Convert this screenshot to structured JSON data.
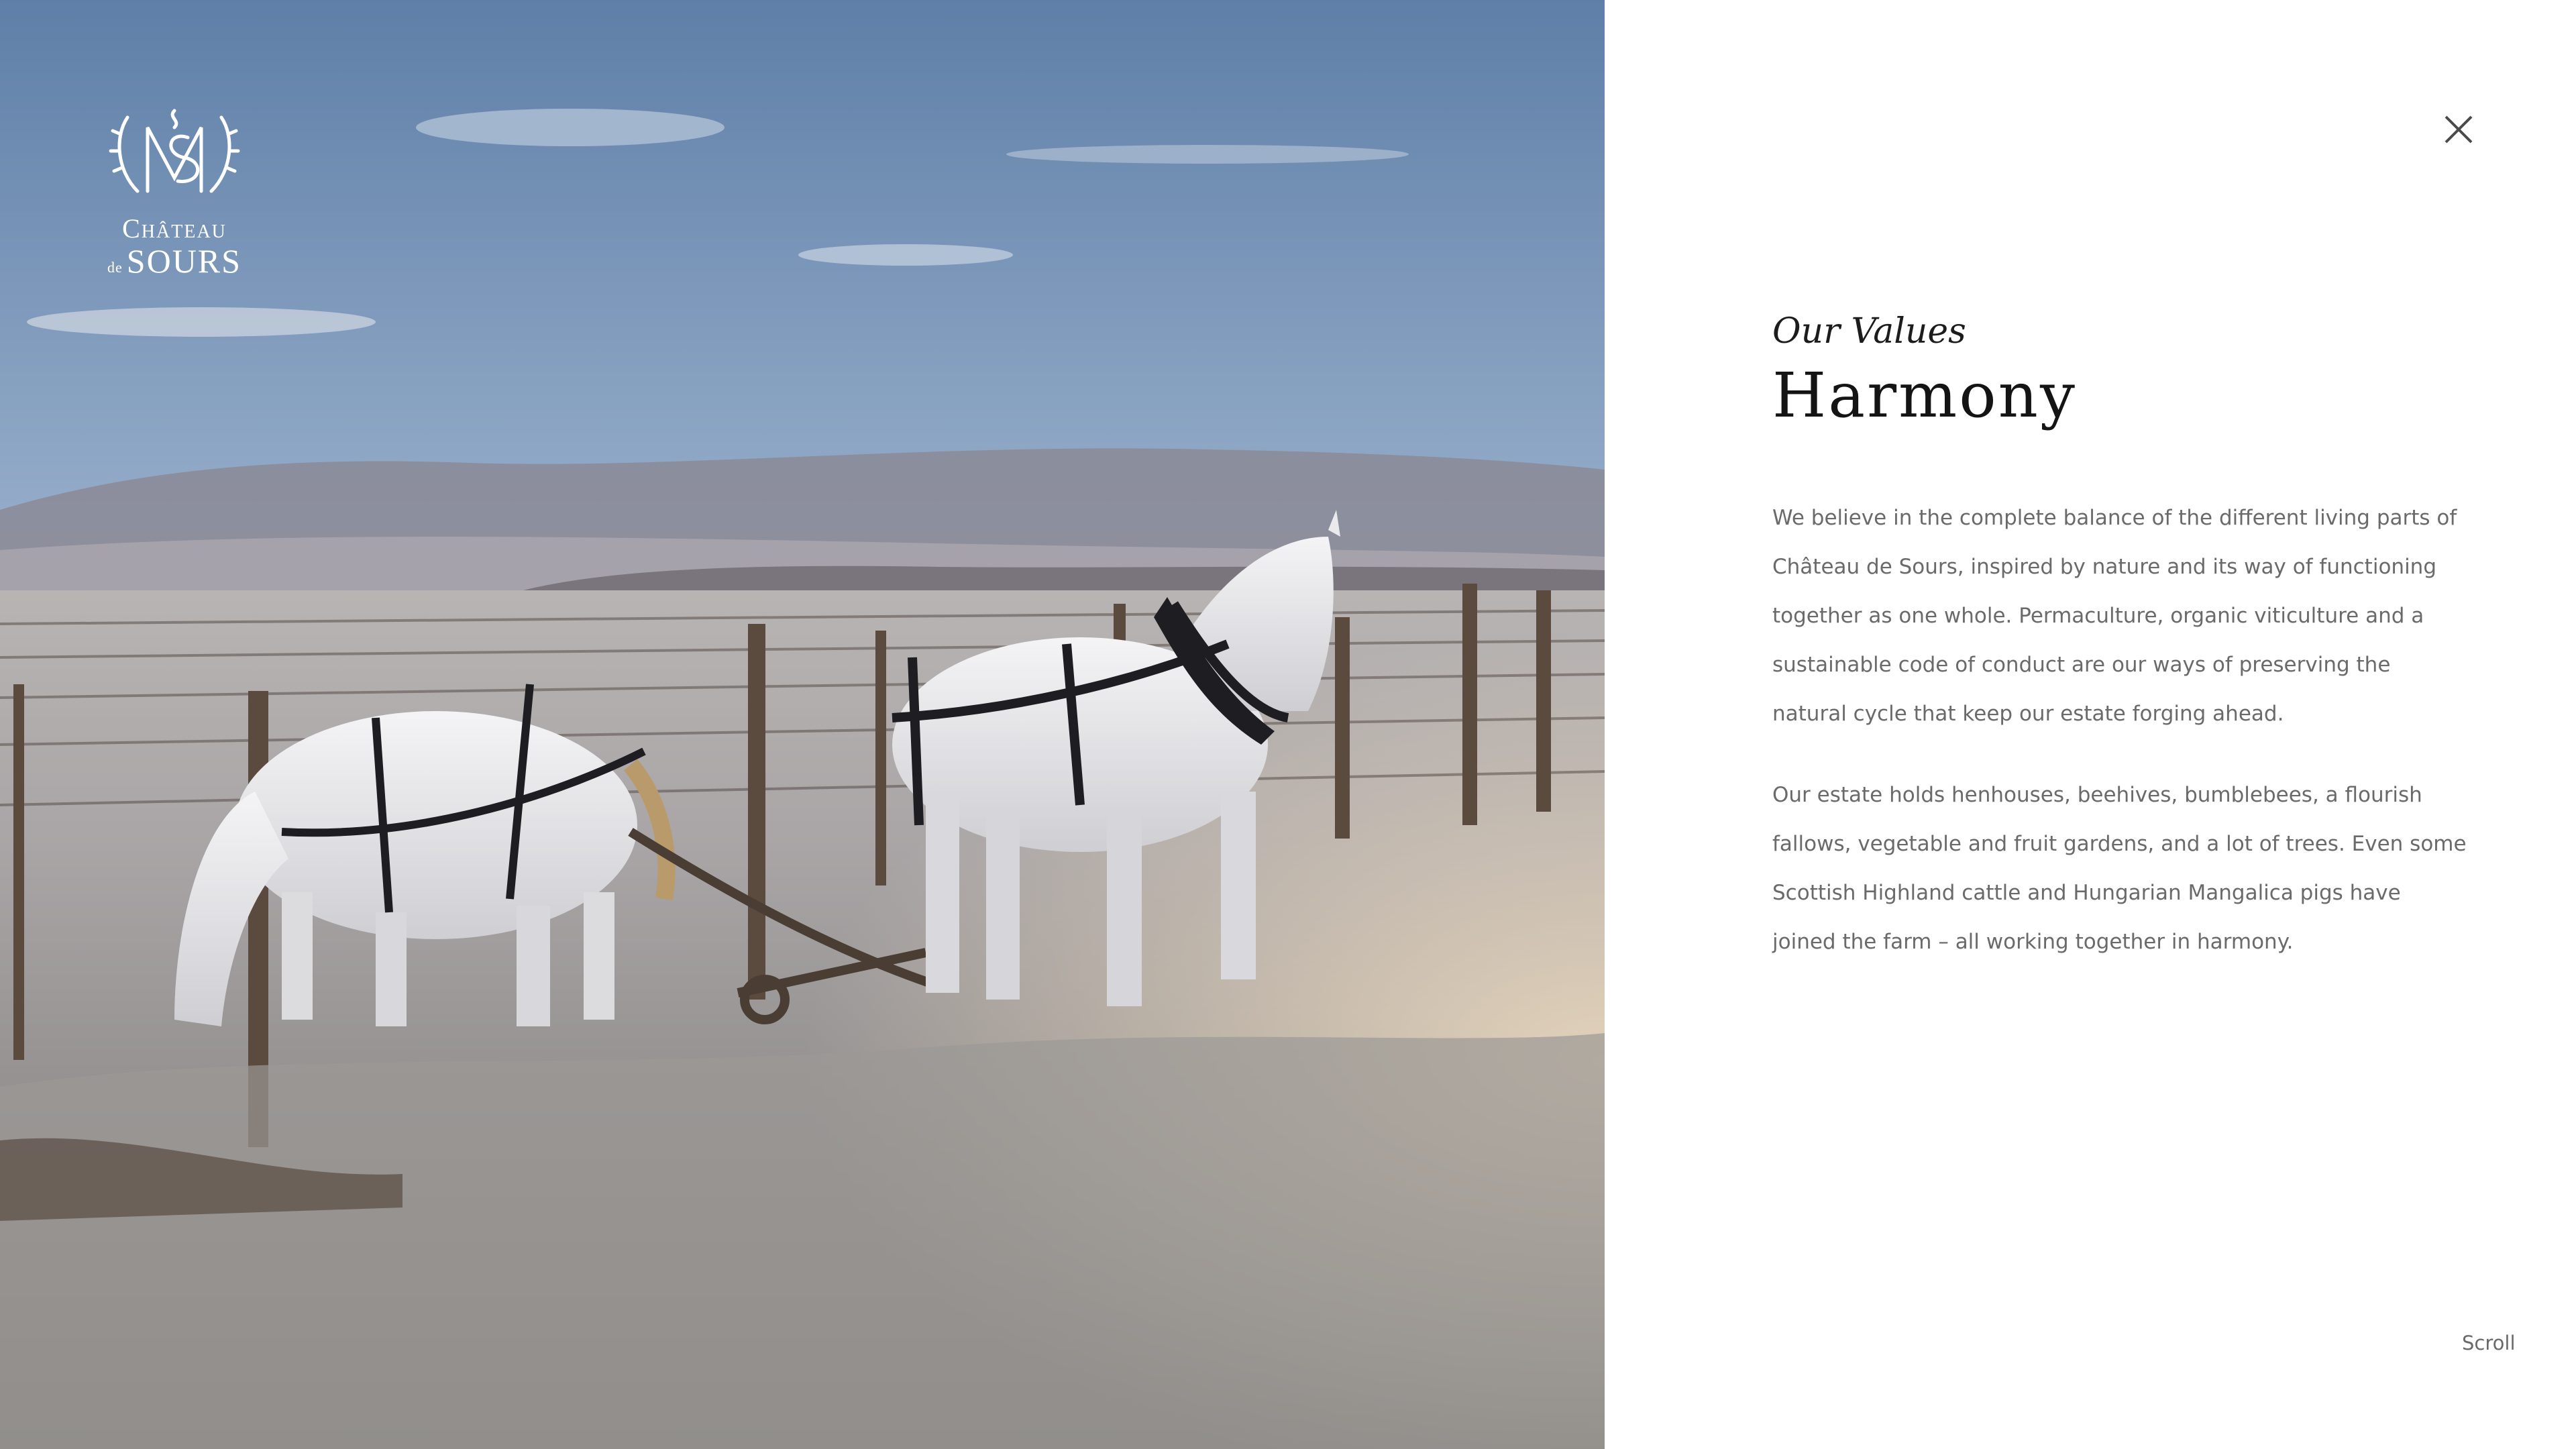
{
  "hero": {
    "image_description_icon": "horses-in-frosty-vineyard-photo",
    "logo": {
      "monogram_icon": "chateau-crest-monogram-icon",
      "line1": "Château",
      "line2_prefix": "de",
      "line2": "SOURS"
    }
  },
  "panel": {
    "close_icon": "close-icon",
    "eyebrow": "Our Values",
    "title": "Harmony",
    "paragraphs": [
      "We believe in the complete balance of the different living parts of Château de Sours, inspired by nature and its way of functioning together as one whole. Permaculture, organic viticulture and a sustainable code of conduct are our ways of preserving the natural cycle that keep our estate forging ahead.",
      "Our estate holds henhouses, beehives, bumblebees, a flourish fallows, vegetable and fruit gardens, and a lot of trees. Even some Scottish Highland cattle and Hungarian Mangalica pigs have joined the farm – all working together in harmony."
    ],
    "scroll_label": "Scroll"
  },
  "colors": {
    "panel_background": "#ffffff",
    "heading_text": "#141414",
    "body_text": "#6a6a6a",
    "logo_text": "#ffffff"
  }
}
